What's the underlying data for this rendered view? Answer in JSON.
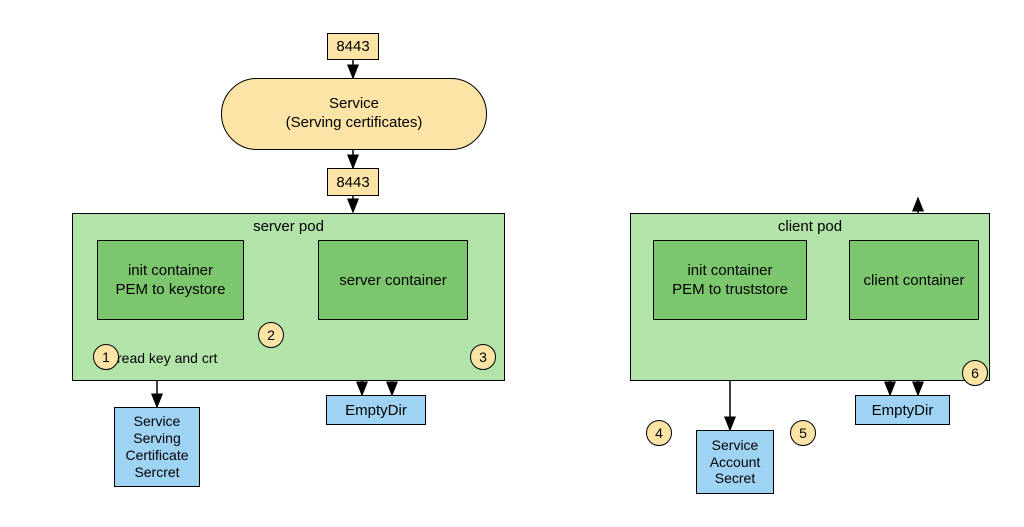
{
  "service": {
    "title_line1": "Service",
    "title_line2": "(Serving certificates)",
    "port_top": "8443",
    "port_bottom": "8443"
  },
  "server_pod": {
    "title": "server pod",
    "init_line1": "init container",
    "init_line2": "PEM to keystore",
    "container": "server container",
    "emptydir": "EmptyDir",
    "secret_line1": "Service",
    "secret_line2": "Serving",
    "secret_line3": "Certificate",
    "secret_line4": "Sercret",
    "edge_label1": "read key and crt"
  },
  "client_pod": {
    "title": "client pod",
    "init_line1": "init container",
    "init_line2": "PEM to truststore",
    "container": "client container",
    "emptydir": "EmptyDir",
    "secret_line1": "Service",
    "secret_line2": "Account",
    "secret_line3": "Secret"
  },
  "steps": {
    "s1": "1",
    "s2": "2",
    "s3": "3",
    "s4": "4",
    "s5": "5",
    "s6": "6"
  }
}
